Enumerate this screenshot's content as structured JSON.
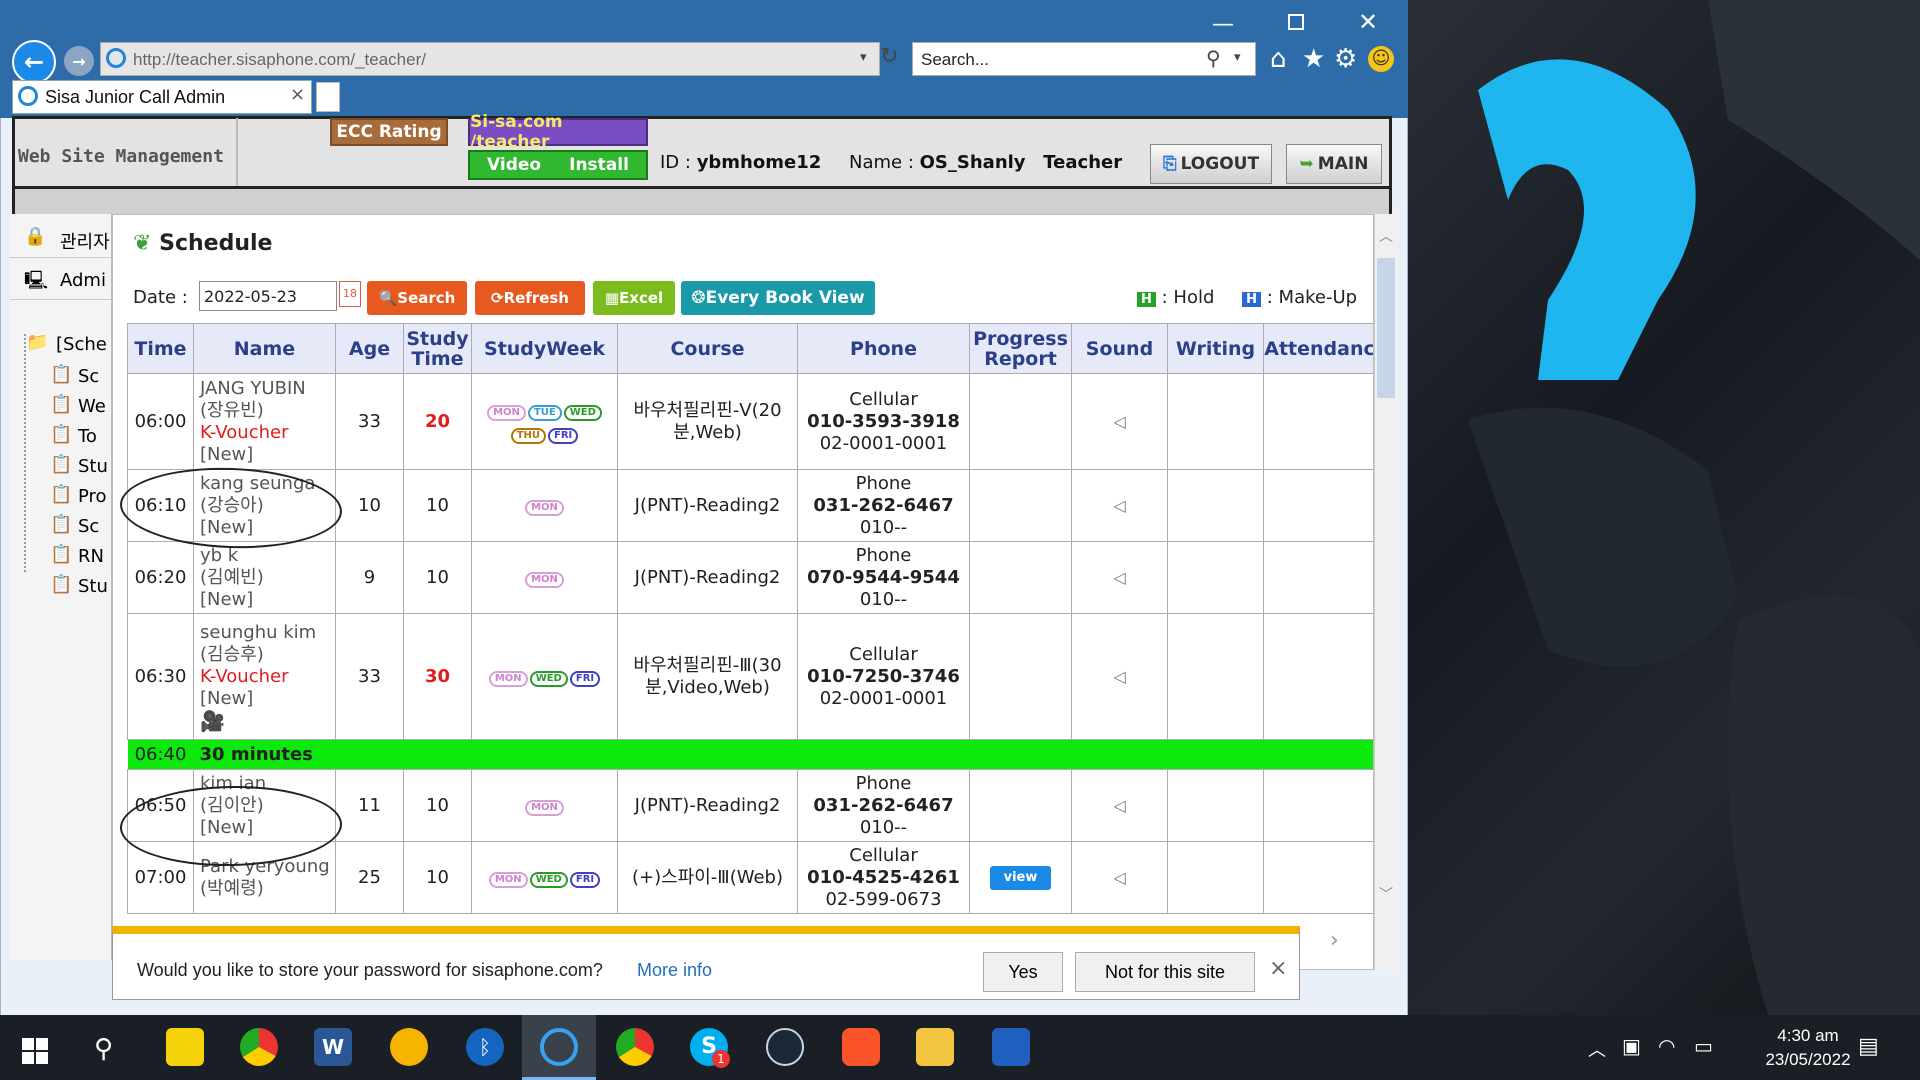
{
  "browser": {
    "url": "http://teacher.sisaphone.com/_teacher/",
    "search_placeholder": "Search...",
    "tab_title": "Sisa Junior Call Admin"
  },
  "header": {
    "site_title": "Web Site Management",
    "ecc_rating": "ECC Rating",
    "sisa_link": "Si-sa.com /teacher",
    "video_label": "Video",
    "install_label": "Install",
    "id_label": "ID : ",
    "id_value": "ybmhome12",
    "name_label": "Name : ",
    "name_value": "OS_Shanly",
    "role": "Teacher",
    "logout": "LOGOUT",
    "main": "MAIN"
  },
  "sidebar": {
    "top_items": [
      "관리자",
      "Admi"
    ],
    "tree_root": "[Sche",
    "tree_items": [
      "Sc",
      "We",
      "To",
      "Stu",
      "Pro",
      "Sc",
      "RN",
      "Stu"
    ]
  },
  "schedule": {
    "title": "Schedule",
    "date_label": "Date : ",
    "date_value": "2022-05-23",
    "buttons": {
      "search": "Search",
      "refresh": "Refresh",
      "excel": "Excel",
      "every_book": "Every Book View"
    },
    "legend_hold_icon": "H",
    "legend_hold": ": Hold",
    "legend_makeup_icon": "H",
    "legend_makeup": ": Make-Up",
    "columns": [
      "Time",
      "Name",
      "Age",
      "Study Time",
      "StudyWeek",
      "Course",
      "Phone",
      "Progress Report",
      "Sound",
      "Writing",
      "Attendanc"
    ],
    "rows": [
      {
        "time": "06:00",
        "name": "JANG YUBIN",
        "kname": "(장유빈)",
        "voucher": "K-Voucher",
        "tag": "[New]",
        "age": "33",
        "study": "20",
        "days": [
          "MON",
          "TUE",
          "WED",
          "THU",
          "FRI"
        ],
        "course": "바우처필리핀-V(20분,Web)",
        "phone_type": "Cellular",
        "phone": "010-3593-3918",
        "phone2": "02-0001-0001"
      },
      {
        "time": "06:10",
        "name": "kang seunga",
        "kname": "(강승아)",
        "voucher": "",
        "tag": "[New]",
        "age": "10",
        "study": "10",
        "days": [
          "MON"
        ],
        "course": "J(PNT)-Reading2",
        "phone_type": "Phone",
        "phone": "031-262-6467",
        "phone2": "010--"
      },
      {
        "time": "06:20",
        "name": "yb k",
        "kname": "(김예빈)",
        "voucher": "",
        "tag": "[New]",
        "age": "9",
        "study": "10",
        "days": [
          "MON"
        ],
        "course": "J(PNT)-Reading2",
        "phone_type": "Phone",
        "phone": "070-9544-9544",
        "phone2": "010--"
      },
      {
        "time": "06:30",
        "name": "seunghu kim",
        "kname": "(김승후)",
        "voucher": "K-Voucher",
        "tag": "[New]",
        "age": "33",
        "study": "30",
        "days": [
          "MON",
          "WED",
          "FRI"
        ],
        "course": "바우처필리핀-Ⅲ(30분,Video,Web)",
        "phone_type": "Cellular",
        "phone": "010-7250-3746",
        "phone2": "02-0001-0001"
      },
      {
        "time": "06:50",
        "name": "kim ian",
        "kname": "(김이안)",
        "voucher": "",
        "tag": "[New]",
        "age": "11",
        "study": "10",
        "days": [
          "MON"
        ],
        "course": "J(PNT)-Reading2",
        "phone_type": "Phone",
        "phone": "031-262-6467",
        "phone2": "010--"
      },
      {
        "time": "07:00",
        "name": "Park yeryoung",
        "kname": "(박예령)",
        "voucher": "",
        "tag": "",
        "age": "25",
        "study": "10",
        "days": [
          "MON",
          "WED",
          "FRI"
        ],
        "course": "(+)스파이-Ⅲ(Web)",
        "phone_type": "Cellular",
        "phone": "010-4525-4261",
        "phone2": "02-599-0673",
        "view": "view"
      }
    ],
    "break_time": "06:40",
    "break_label": "30 minutes"
  },
  "password_bar": {
    "message": "Would you like to store your password for sisaphone.com?",
    "more_info": "More info",
    "yes": "Yes",
    "not_for_site": "Not for this site",
    "close": "×"
  },
  "taskbar": {
    "time": "4:30 am",
    "date": "23/05/2022",
    "skype_badge": "1"
  },
  "colors": {
    "nav": "#2d6ca8",
    "highlight_row": "#0de80d",
    "red": "#e21b1b"
  }
}
